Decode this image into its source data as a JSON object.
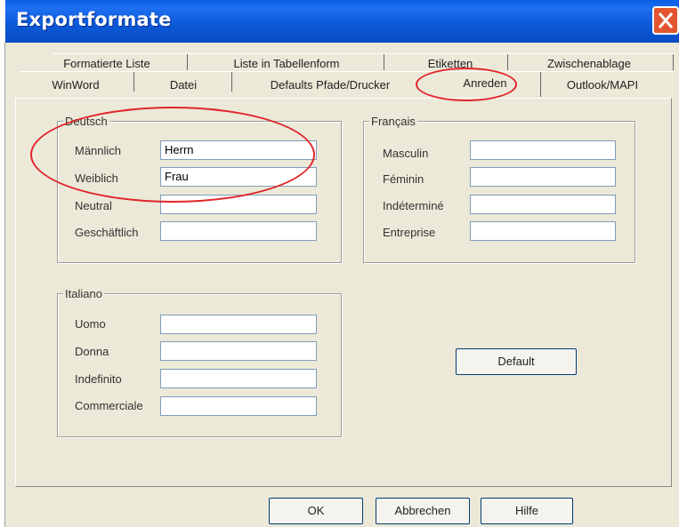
{
  "window": {
    "title": "Exportformate"
  },
  "tabs": {
    "row1": [
      "Formatierte Liste",
      "Liste in Tabellenform",
      "Etiketten",
      "Zwischenablage"
    ],
    "row2": [
      "WinWord",
      "Datei",
      "Defaults Pfade/Drucker",
      "Anreden",
      "Outlook/MAPI"
    ],
    "active": "Anreden"
  },
  "deutsch": {
    "legend": "Deutsch",
    "rows": [
      {
        "label": "Männlich",
        "value": "Herrn"
      },
      {
        "label": "Weiblich",
        "value": "Frau"
      },
      {
        "label": "Neutral",
        "value": ""
      },
      {
        "label": "Geschäftlich",
        "value": ""
      }
    ]
  },
  "francais": {
    "legend": "Français",
    "rows": [
      {
        "label": "Masculin",
        "value": ""
      },
      {
        "label": "Féminin",
        "value": ""
      },
      {
        "label": "Indéterminé",
        "value": ""
      },
      {
        "label": "Entreprise",
        "value": ""
      }
    ]
  },
  "italiano": {
    "legend": "Italiano",
    "rows": [
      {
        "label": "Uomo",
        "value": ""
      },
      {
        "label": "Donna",
        "value": ""
      },
      {
        "label": "Indefinito",
        "value": ""
      },
      {
        "label": "Commerciale",
        "value": ""
      }
    ]
  },
  "buttons": {
    "default": "Default",
    "ok": "OK",
    "cancel": "Abbrechen",
    "help": "Hilfe"
  },
  "colors": {
    "titlebar": "#0a5ee6",
    "annotation": "#e0242a",
    "close": "#e3552e"
  }
}
